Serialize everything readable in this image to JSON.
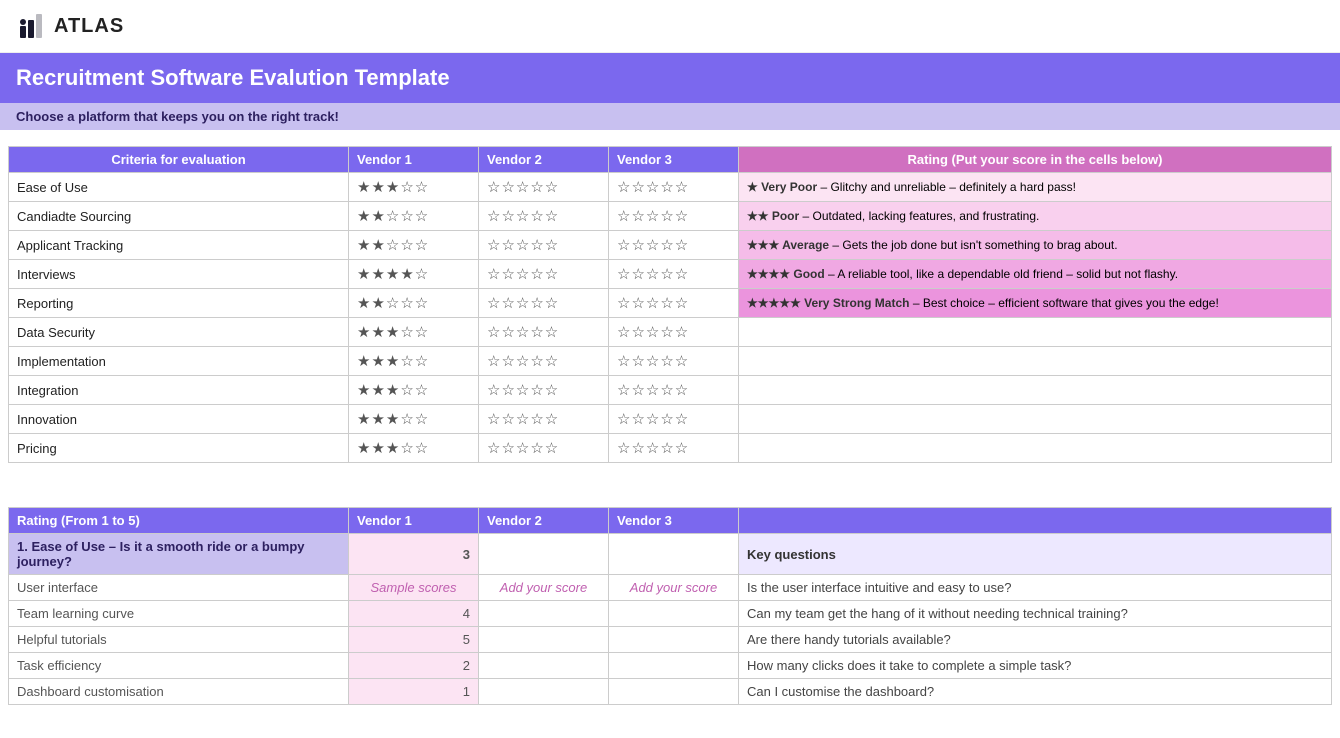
{
  "header": {
    "logo_text": "ATLAS"
  },
  "title": "Recruitment Software Evalution Template",
  "subtitle": "Choose a platform that keeps you on the right track!",
  "eval_table": {
    "headers": [
      "Criteria for evaluation",
      "Vendor 1",
      "Vendor 2",
      "Vendor 3",
      "Rating (Put your score in the cells below)"
    ],
    "rows": [
      {
        "criteria": "Ease of Use",
        "v1": "★★★☆☆",
        "v2": "☆☆☆☆☆",
        "v3": "☆☆☆☆☆"
      },
      {
        "criteria": "Candiadte Sourcing",
        "v1": "★★☆☆☆",
        "v2": "☆☆☆☆☆",
        "v3": "☆☆☆☆☆"
      },
      {
        "criteria": "Applicant Tracking",
        "v1": "★★☆☆☆",
        "v2": "☆☆☆☆☆",
        "v3": "☆☆☆☆☆"
      },
      {
        "criteria": "Interviews",
        "v1": "★★★★☆",
        "v2": "☆☆☆☆☆",
        "v3": "☆☆☆☆☆"
      },
      {
        "criteria": "Reporting",
        "v1": "★★☆☆☆",
        "v2": "☆☆☆☆☆",
        "v3": "☆☆☆☆☆"
      },
      {
        "criteria": "Data Security",
        "v1": "★★★☆☆",
        "v2": "☆☆☆☆☆",
        "v3": "☆☆☆☆☆"
      },
      {
        "criteria": "Implementation",
        "v1": "★★★☆☆",
        "v2": "☆☆☆☆☆",
        "v3": "☆☆☆☆☆"
      },
      {
        "criteria": "Integration",
        "v1": "★★★☆☆",
        "v2": "☆☆☆☆☆",
        "v3": "☆☆☆☆☆"
      },
      {
        "criteria": "Innovation",
        "v1": "★★★☆☆",
        "v2": "☆☆☆☆☆",
        "v3": "☆☆☆☆☆"
      },
      {
        "criteria": "Pricing",
        "v1": "★★★☆☆",
        "v2": "☆☆☆☆☆",
        "v3": "☆☆☆☆☆"
      }
    ],
    "ratings": [
      {
        "stars": "★ Very Poor",
        "desc": "– Glitchy and unreliable – definitely a hard pass!"
      },
      {
        "stars": "★★ Poor",
        "desc": "– Outdated, lacking features, and frustrating."
      },
      {
        "stars": "★★★ Average",
        "desc": "– Gets the job done but isn't something to brag about."
      },
      {
        "stars": "★★★★ Good",
        "desc": "– A reliable tool, like a dependable old friend – solid but not flashy."
      },
      {
        "stars": "★★★★★ Very Strong Match",
        "desc": "– Best choice – efficient software that gives you the edge!"
      }
    ]
  },
  "score_table": {
    "headers": [
      "Rating (From 1 to 5)",
      "Vendor 1",
      "Vendor 2",
      "Vendor 3",
      ""
    ],
    "ease_header": "1. Ease of Use – Is it a smooth ride or a bumpy journey?",
    "ease_v1": "3",
    "ease_key": "Key questions",
    "rows": [
      {
        "label": "User interface",
        "v1": "Sample scores",
        "v2": "Add your score",
        "v3": "Add your score",
        "key": "Is the user interface intuitive and easy to use?"
      },
      {
        "label": "Team learning curve",
        "v1": "4",
        "v2": "",
        "v3": "",
        "key": "Can my team get the hang of it without needing technical training?"
      },
      {
        "label": "Helpful tutorials",
        "v1": "5",
        "v2": "",
        "v3": "",
        "key": "Are there handy tutorials available?"
      },
      {
        "label": "Task efficiency",
        "v1": "2",
        "v2": "",
        "v3": "",
        "key": "How many clicks does it take to complete a simple task?"
      },
      {
        "label": "Dashboard customisation",
        "v1": "1",
        "v2": "",
        "v3": "",
        "key": "Can I customise the dashboard?"
      }
    ]
  }
}
